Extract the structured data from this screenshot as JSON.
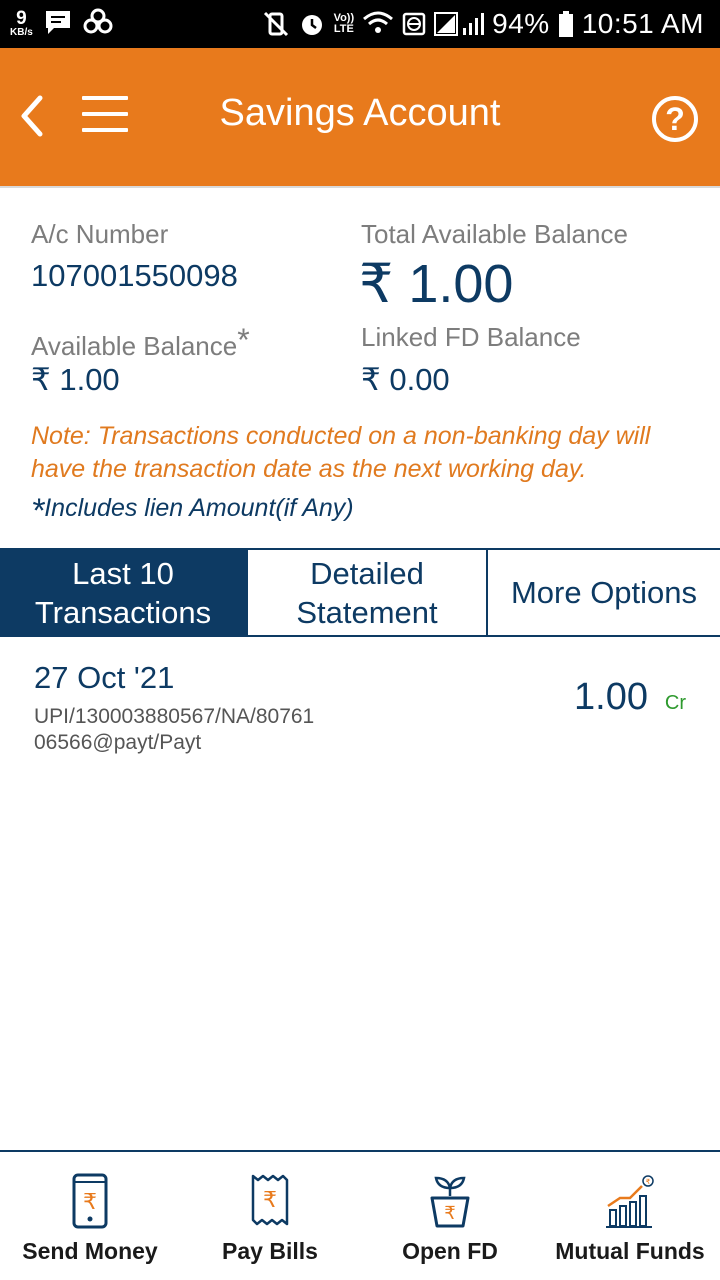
{
  "status_bar": {
    "net_speed": "9",
    "net_unit": "KB/s",
    "volte": "Vo))",
    "lte": "LTE",
    "battery": "94%",
    "time": "10:51 AM"
  },
  "header": {
    "title": "Savings Account",
    "help_symbol": "?"
  },
  "account": {
    "ac_number_label": "A/c Number",
    "ac_number": "107001550098",
    "total_balance_label": "Total Available Balance",
    "total_balance": "₹ 1.00",
    "available_balance_label": "Available Balance",
    "available_balance_star": "*",
    "available_balance": "₹ 1.00",
    "linked_fd_label": "Linked FD Balance",
    "linked_fd_balance": "₹ 0.00",
    "note": "Note: Transactions conducted on a non-banking day will have the transaction date as the next working day.",
    "lien_star": "*",
    "lien_note": "Includes lien Amount(if Any)"
  },
  "tabs": [
    {
      "label_line1": "Last 10",
      "label_line2": "Transactions",
      "active": true
    },
    {
      "label_line1": "Detailed",
      "label_line2": "Statement",
      "active": false
    },
    {
      "label_line1": "More Options",
      "label_line2": "",
      "active": false
    }
  ],
  "transactions": [
    {
      "date": "27 Oct '21",
      "description_line1": "UPI/130003880567/NA/80761",
      "description_line2": "06566@payt/Payt",
      "amount": "1.00",
      "type": "Cr"
    }
  ],
  "bottom_nav": [
    {
      "label": "Send Money",
      "icon": "phone-rupee-icon"
    },
    {
      "label": "Pay Bills",
      "icon": "bill-rupee-icon"
    },
    {
      "label": "Open FD",
      "icon": "plant-pot-icon"
    },
    {
      "label": "Mutual Funds",
      "icon": "growth-chart-icon"
    }
  ],
  "colors": {
    "header_orange": "#e87a1c",
    "navy": "#0d3a63",
    "note_orange": "#e07a1f",
    "credit_green": "#2e9a2e"
  }
}
